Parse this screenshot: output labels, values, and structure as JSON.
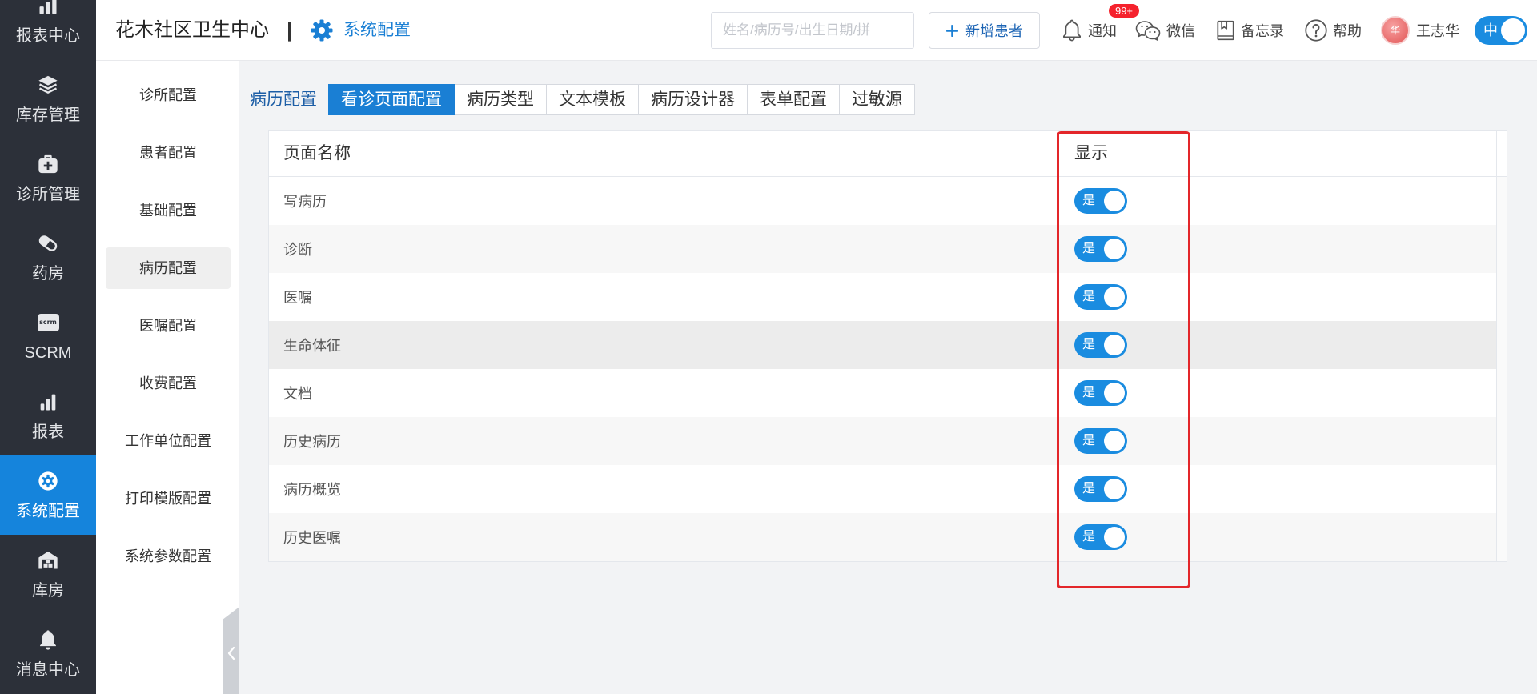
{
  "header": {
    "clinic_name": "花木社区卫生中心",
    "separator": "|",
    "section_icon": "gear-icon",
    "section_title": "系统配置",
    "search": {
      "placeholder": "姓名/病历号/出生日期/拼",
      "value": ""
    },
    "add_patient_button": {
      "icon": "plus-icon",
      "label": "新增患者"
    },
    "notifications": {
      "icon": "bell-icon",
      "label": "通知",
      "badge": "99+"
    },
    "wechat": {
      "icon": "wechat-icon",
      "label": "微信"
    },
    "memo": {
      "icon": "bookmark-book-icon",
      "label": "备忘录"
    },
    "help": {
      "icon": "help-circle-icon",
      "label": "帮助"
    },
    "user": {
      "avatar_text": "华",
      "name": "王志华"
    },
    "language_switch": {
      "label": "中",
      "on": true
    }
  },
  "nav": {
    "active_index": 6,
    "items": [
      {
        "label": "报表中心",
        "icon": "bar-chart-icon"
      },
      {
        "label": "库存管理",
        "icon": "layers-icon"
      },
      {
        "label": "诊所管理",
        "icon": "medical-kit-icon"
      },
      {
        "label": "药房",
        "icon": "pill-icon"
      },
      {
        "label": "SCRM",
        "icon": "scrm-icon",
        "icon_text": "scrm"
      },
      {
        "label": "报表",
        "icon": "bar-chart-icon"
      },
      {
        "label": "系统配置",
        "icon": "gear-icon"
      },
      {
        "label": "库房",
        "icon": "warehouse-icon"
      },
      {
        "label": "消息中心",
        "icon": "bell-icon"
      }
    ]
  },
  "submenu": {
    "active_index": 3,
    "items": [
      "诊所配置",
      "患者配置",
      "基础配置",
      "病历配置",
      "医嘱配置",
      "收费配置",
      "工作单位配置",
      "打印模版配置",
      "系统参数配置"
    ],
    "collapse_icon": "chevron-left-icon"
  },
  "tabs": {
    "group_label": "病历配置",
    "active_index": 0,
    "items": [
      "看诊页面配置",
      "病历类型",
      "文本模板",
      "病历设计器",
      "表单配置",
      "过敏源"
    ]
  },
  "table": {
    "columns": [
      "页面名称",
      "显示"
    ],
    "toggle_on_label": "是",
    "rows": [
      {
        "name": "写病历",
        "show": true
      },
      {
        "name": "诊断",
        "show": true
      },
      {
        "name": "医嘱",
        "show": true
      },
      {
        "name": "生命体征",
        "show": true
      },
      {
        "name": "文档",
        "show": true
      },
      {
        "name": "历史病历",
        "show": true
      },
      {
        "name": "病历概览",
        "show": true
      },
      {
        "name": "历史医嘱",
        "show": true
      }
    ]
  },
  "colors": {
    "primary": "#1a7fd4",
    "sidebar_bg": "#2c3039",
    "nav_active": "#1584dc",
    "switch_on": "#1a8ce0",
    "badge": "#f5222d",
    "highlight_box": "#e3262a"
  }
}
